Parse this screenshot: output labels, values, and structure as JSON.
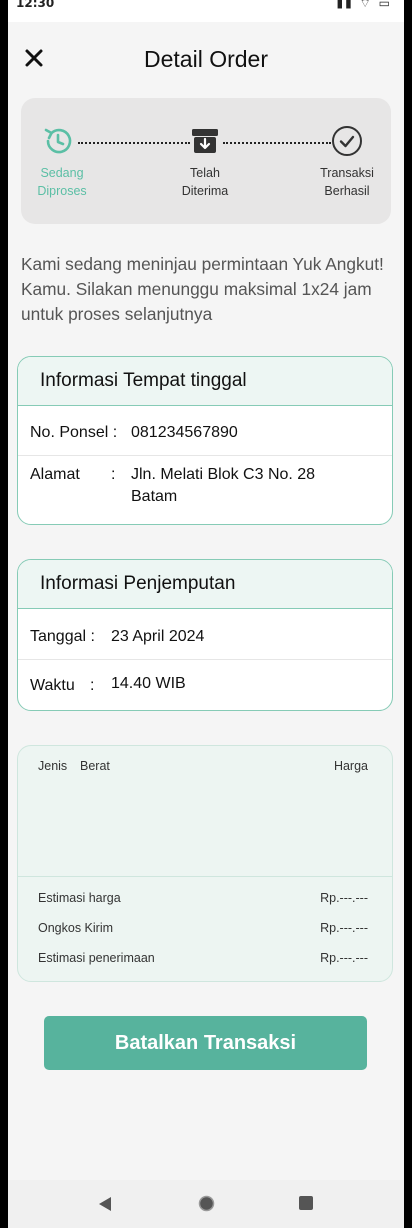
{
  "status": {
    "time": "12:30"
  },
  "header": {
    "title": "Detail Order"
  },
  "stepper": {
    "steps": [
      {
        "line1": "Sedang",
        "line2": "Diproses"
      },
      {
        "line1": "Telah",
        "line2": "Diterima"
      },
      {
        "line1": "Transaksi",
        "line2": "Berhasil"
      }
    ],
    "active_index": 0,
    "colors": {
      "active": "#5bbfa5",
      "inactive": "#333333"
    }
  },
  "notice": "Kami sedang meninjau permintaan Yuk Angkut! Kamu. Silakan menunggu maksimal 1x24 jam untuk proses selanjutnya",
  "residence": {
    "title": "Informasi Tempat tinggal",
    "phone_label": "No. Ponsel :",
    "phone_value": "081234567890",
    "address_label": "Alamat",
    "address_colon": ":",
    "address_line1": "Jln. Melati Blok C3 No. 28",
    "address_line2": "Batam"
  },
  "pickup": {
    "title": "Informasi Penjemputan",
    "date_label": "Tanggal :",
    "date_value": "23 April 2024",
    "time_label": "Waktu",
    "time_colon": ":",
    "time_value": "14.40 WIB"
  },
  "summary": {
    "col_type": "Jenis",
    "col_weight": "Berat",
    "col_price": "Harga",
    "rows": [
      {
        "label": "Estimasi harga",
        "value": "Rp.---.---"
      },
      {
        "label": "Ongkos Kirim",
        "value": "Rp.---.---"
      },
      {
        "label": "Estimasi penerimaan",
        "value": "Rp.---.---"
      }
    ]
  },
  "actions": {
    "cancel_label": "Batalkan Transaksi"
  },
  "theme": {
    "accent": "#57b39d",
    "card_border": "#86cbb6"
  }
}
